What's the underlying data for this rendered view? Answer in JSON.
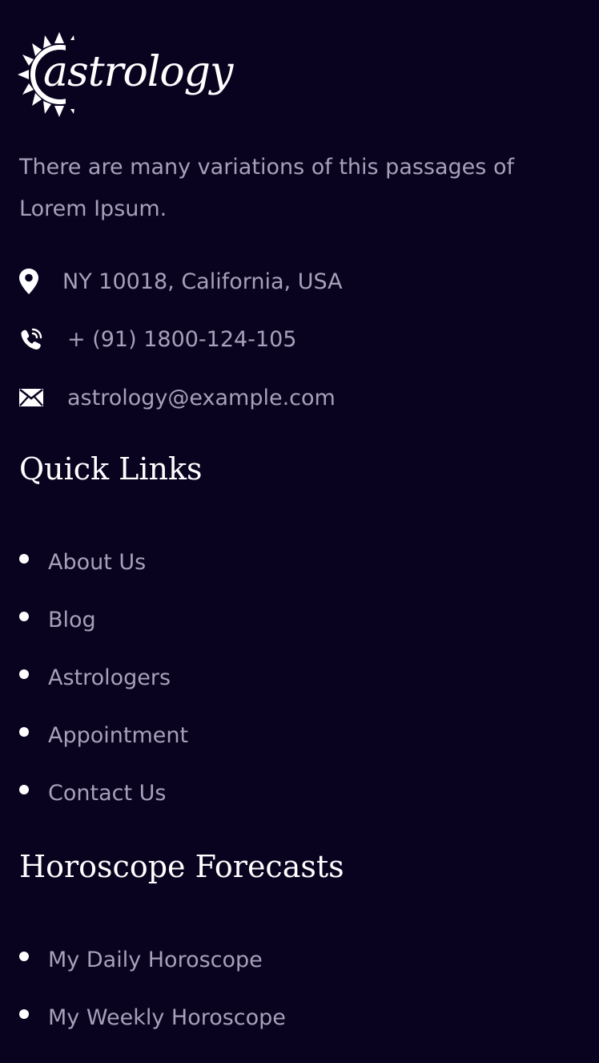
{
  "brand": {
    "logo_text": "astrology"
  },
  "about": {
    "text": "There are many variations of this passages of Lorem Ipsum."
  },
  "contact": {
    "address": "NY 10018, California, USA",
    "phone": "+ (91) 1800-124-105",
    "email": "astrology@example.com",
    "icons": [
      "location-pin-icon",
      "phone-icon",
      "mail-icon"
    ]
  },
  "quick_links": {
    "title": "Quick Links",
    "items": [
      "About Us",
      "Blog",
      "Astrologers",
      "Appointment",
      "Contact Us"
    ]
  },
  "horoscope": {
    "title": "Horoscope Forecasts",
    "items": [
      "My Daily Horoscope",
      "My Weekly Horoscope"
    ]
  },
  "colors": {
    "background": "#0a0320",
    "text_muted": "#a6a0b8",
    "heading": "#ffffff"
  }
}
